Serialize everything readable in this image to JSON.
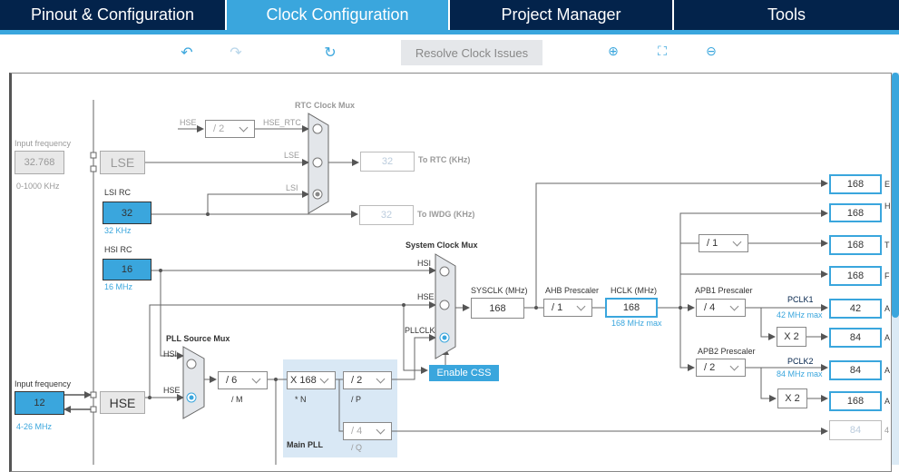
{
  "tabs": [
    {
      "label": "Pinout & Configuration"
    },
    {
      "label": "Clock Configuration"
    },
    {
      "label": "Project Manager"
    },
    {
      "label": "Tools"
    }
  ],
  "toolbar": {
    "undo_icon": "undo-icon",
    "redo_icon": "redo-icon",
    "reset_icon": "reset-icon",
    "resolve_label": "Resolve Clock Issues",
    "zoom_in_icon": "zoom-in-icon",
    "fit_icon": "fit-icon",
    "zoom_out_icon": "zoom-out-icon"
  },
  "colors": {
    "accent": "#3aa6dd",
    "tab_bg": "#03234b"
  },
  "lse": {
    "input_label": "Input frequency",
    "input_value": "32.768",
    "range": "0-1000 KHz",
    "label": "LSE"
  },
  "rtc": {
    "hse_label": "HSE",
    "divider": "/ 2",
    "hse_rtc_label": "HSE_RTC",
    "mux_title": "RTC Clock Mux",
    "lse_label": "LSE",
    "lsi_label": "LSI",
    "rtc_value": "32",
    "rtc_label": "To RTC (KHz)",
    "iwdg_value": "32",
    "iwdg_label": "To IWDG (KHz)"
  },
  "lsi": {
    "label": "LSI RC",
    "value": "32",
    "freq": "32 KHz"
  },
  "hsi": {
    "label": "HSI RC",
    "value": "16",
    "freq": "16 MHz"
  },
  "sysmux": {
    "title": "System Clock Mux",
    "hsi": "HSI",
    "hse": "HSE",
    "pllclk": "PLLCLK",
    "enable_css": "Enable CSS"
  },
  "sysclk": {
    "label": "SYSCLK (MHz)",
    "value": "168"
  },
  "ahb": {
    "label": "AHB Prescaler",
    "value": "/ 1"
  },
  "hclk": {
    "label": "HCLK (MHz)",
    "value": "168",
    "max": "168 MHz max"
  },
  "apb1": {
    "label": "APB1 Prescaler",
    "value": "/ 4",
    "pclk": "PCLK1",
    "max": "42 MHz max",
    "x2": "X 2"
  },
  "apb2": {
    "label": "APB2 Prescaler",
    "value": "/ 2",
    "pclk": "PCLK2",
    "max": "84 MHz max",
    "x2": "X 2"
  },
  "timer_div": "/ 1",
  "outputs": [
    {
      "value": "168",
      "label": "E"
    },
    {
      "value": "168",
      "label": "H"
    },
    {
      "value": "168",
      "label": "T"
    },
    {
      "value": "168",
      "label": "F"
    },
    {
      "value": "42",
      "label": "A"
    },
    {
      "value": "84",
      "label": "A"
    },
    {
      "value": "84",
      "label": "A"
    },
    {
      "value": "168",
      "label": "A"
    },
    {
      "value": "84",
      "label": "4"
    }
  ],
  "pllsrc": {
    "title": "PLL Source Mux",
    "hsi": "HSI",
    "hse": "HSE"
  },
  "pll": {
    "m": "/ 6",
    "m_label": "/ M",
    "n": "X 168",
    "n_label": "* N",
    "p": "/ 2",
    "p_label": "/ P",
    "q": "/ 4",
    "q_label": "/ Q",
    "title": "Main PLL"
  },
  "hse": {
    "input_label": "Input frequency",
    "input_value": "12",
    "range": "4-26 MHz",
    "label": "HSE"
  }
}
